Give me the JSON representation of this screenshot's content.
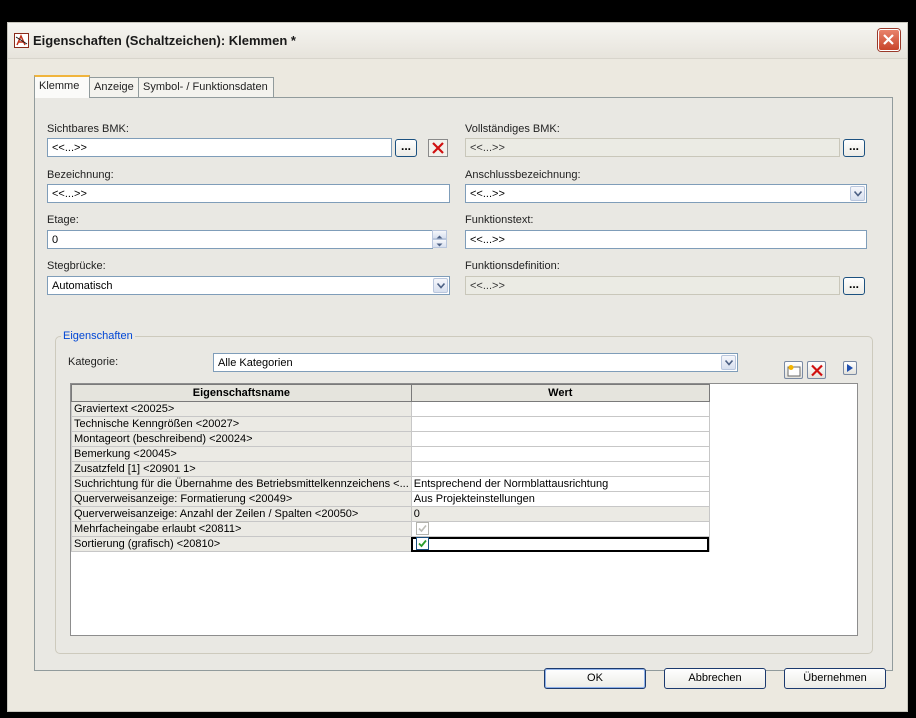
{
  "window": {
    "title": "Eigenschaften (Schaltzeichen): Klemmen *"
  },
  "icons": {
    "app": "app-icon",
    "close": "close-icon",
    "browse": "ellipsis-icon",
    "delete": "delete-x-icon",
    "dropdown": "chevron-down-icon",
    "spin": "spinner-arrows-icon",
    "new": "new-property-icon",
    "play": "play-arrow-icon",
    "check": "check-icon"
  },
  "tabs": [
    {
      "label": "Klemme",
      "active": true
    },
    {
      "label": "Anzeige",
      "active": false
    },
    {
      "label": "Symbol- / Funktionsdaten",
      "active": false
    }
  ],
  "left": {
    "sichtbares_bmk": {
      "label": "Sichtbares BMK:",
      "value": "<<...>>"
    },
    "bezeichnung": {
      "label": "Bezeichnung:",
      "value": "<<...>>"
    },
    "etage": {
      "label": "Etage:",
      "value": "0"
    },
    "stegbruecke": {
      "label": "Stegbrücke:",
      "value": "Automatisch"
    }
  },
  "right": {
    "vollstaendiges_bmk": {
      "label": "Vollständiges BMK:",
      "value": "<<...>>"
    },
    "anschlussbezeichnung": {
      "label": "Anschlussbezeichnung:",
      "value": "<<...>>"
    },
    "funktionstext": {
      "label": "Funktionstext:",
      "value": "<<...>>"
    },
    "funktionsdefinition": {
      "label": "Funktionsdefinition:",
      "value": "<<...>>"
    }
  },
  "eigenschaften": {
    "group_title": "Eigenschaften",
    "kategorie_label": "Kategorie:",
    "kategorie_value": "Alle Kategorien",
    "columns": [
      "Eigenschaftsname",
      "Wert"
    ],
    "rows": [
      {
        "name": "Graviertext <20025>",
        "value": ""
      },
      {
        "name": "Technische Kenngrößen <20027>",
        "value": ""
      },
      {
        "name": "Montageort (beschreibend) <20024>",
        "value": ""
      },
      {
        "name": "Bemerkung <20045>",
        "value": ""
      },
      {
        "name": "Zusatzfeld [1] <20901 1>",
        "value": ""
      },
      {
        "name": "Suchrichtung für die Übernahme des Betriebsmittelkennzeichens <...",
        "value": "Entsprechend der Normblattausrichtung"
      },
      {
        "name": "Querverweisanzeige: Formatierung <20049>",
        "value": "Aus Projekteinstellungen"
      },
      {
        "name": "Querverweisanzeige: Anzahl der Zeilen / Spalten <20050>",
        "value": "0"
      },
      {
        "name": "Mehrfacheingabe erlaubt <20811>",
        "value": "checked-disabled"
      },
      {
        "name": "Sortierung (grafisch) <20810>",
        "value": "checked"
      }
    ]
  },
  "footer": {
    "ok": "OK",
    "cancel": "Abbrechen",
    "apply": "Übernehmen"
  },
  "colors": {
    "group_title": "#0046d5",
    "check": "#2a9d2a",
    "delete": "#d01010"
  }
}
